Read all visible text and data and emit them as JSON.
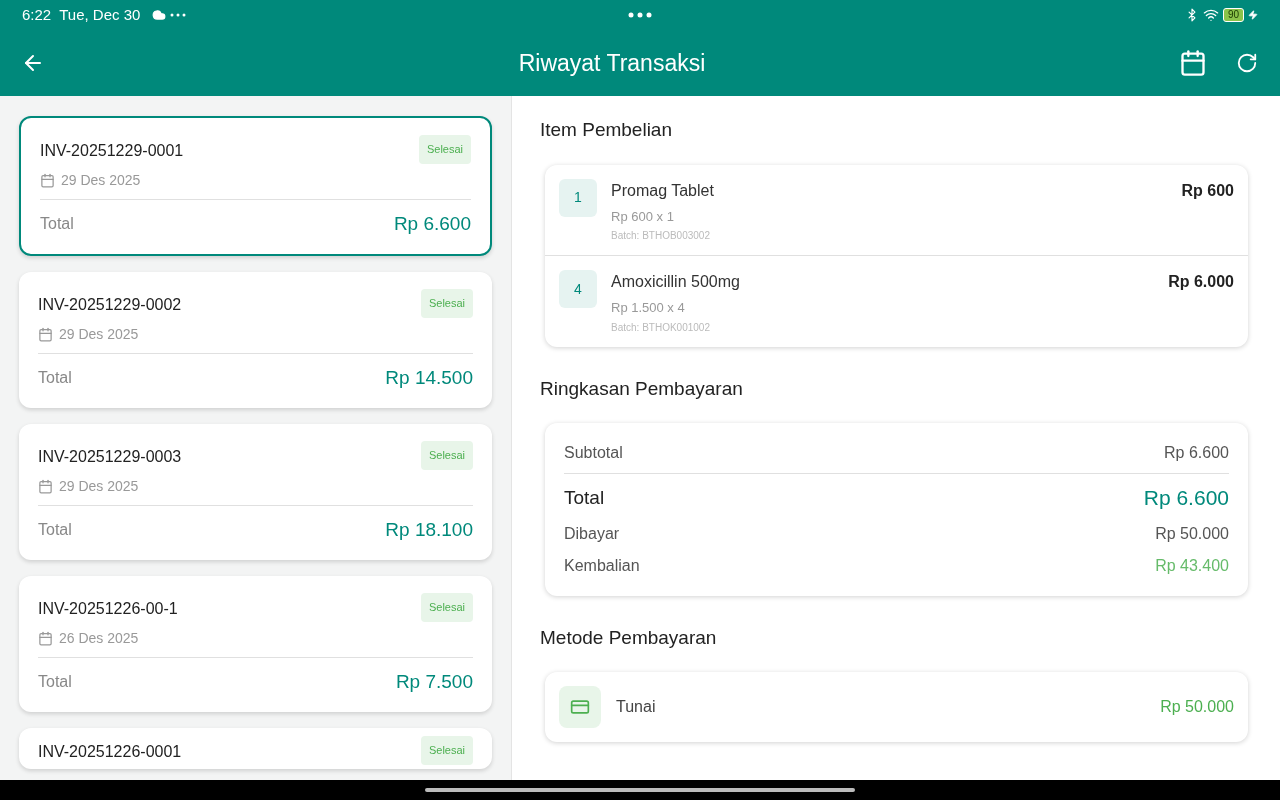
{
  "status_bar": {
    "time": "6:22",
    "date": "Tue, Dec 30",
    "battery": "90"
  },
  "header": {
    "title": "Riwayat Transaksi"
  },
  "transactions": [
    {
      "invoice": "INV-20251229-0001",
      "status": "Selesai",
      "date": "29 Des 2025",
      "total_label": "Total",
      "total": "Rp 6.600",
      "selected": true
    },
    {
      "invoice": "INV-20251229-0002",
      "status": "Selesai",
      "date": "29 Des 2025",
      "total_label": "Total",
      "total": "Rp 14.500",
      "selected": false
    },
    {
      "invoice": "INV-20251229-0003",
      "status": "Selesai",
      "date": "29 Des 2025",
      "total_label": "Total",
      "total": "Rp 18.100",
      "selected": false
    },
    {
      "invoice": "INV-20251226-00-1",
      "status": "Selesai",
      "date": "26 Des 2025",
      "total_label": "Total",
      "total": "Rp 7.500",
      "selected": false
    },
    {
      "invoice": "INV-20251226-0001",
      "status": "Selesai",
      "selected": false
    }
  ],
  "detail": {
    "items_title": "Item Pembelian",
    "items": [
      {
        "qty": "1",
        "name": "Promag Tablet",
        "price_line": "Rp 600 x 1",
        "batch": "Batch: BTHOB003002",
        "amount": "Rp 600"
      },
      {
        "qty": "4",
        "name": "Amoxicillin 500mg",
        "price_line": "Rp 1.500 x 4",
        "batch": "Batch: BTHOK001002",
        "amount": "Rp 6.000"
      }
    ],
    "summary_title": "Ringkasan Pembayaran",
    "summary": [
      {
        "kind": "plain",
        "label": "Subtotal",
        "value": "Rp 6.600"
      },
      {
        "kind": "total",
        "label": "Total",
        "value": "Rp 6.600"
      },
      {
        "kind": "plain",
        "label": "Dibayar",
        "value": "Rp 50.000"
      },
      {
        "kind": "change",
        "label": "Kembalian",
        "value": "Rp 43.400"
      }
    ],
    "method_title": "Metode Pembayaran",
    "method": {
      "name": "Tunai",
      "amount": "Rp 50.000"
    }
  }
}
